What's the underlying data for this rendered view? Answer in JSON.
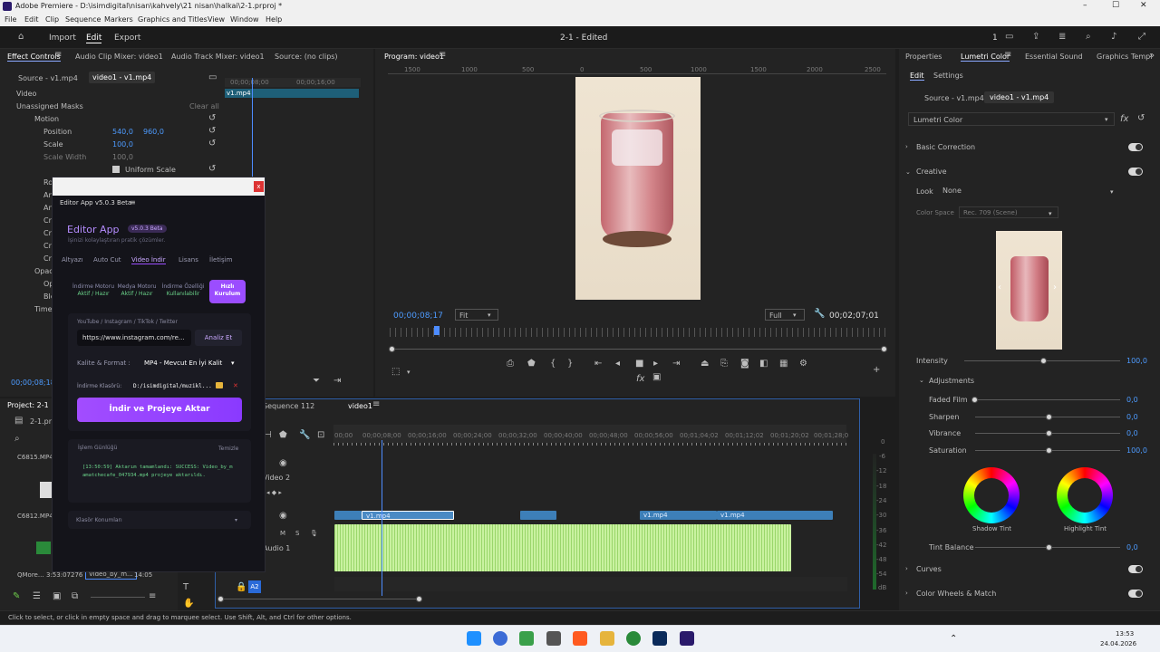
{
  "titlebar": {
    "title": "Adobe Premiere - D:\\isimdigital\\nisan\\kahvely\\21 nisan\\halkai\\2-1.prproj *",
    "minimize": "–",
    "maximize": "☐",
    "close": "✕"
  },
  "menu": [
    "File",
    "Edit",
    "Clip",
    "Sequence",
    "Markers",
    "Graphics and Titles",
    "View",
    "Window",
    "Help"
  ],
  "appbar": {
    "home_icon": "home-icon",
    "tabs": [
      "Import",
      "Edit",
      "Export"
    ],
    "active_tab": "Edit",
    "center_title": "2-1 - Edited",
    "right_num": "1"
  },
  "effect_controls": {
    "tabs": [
      "Effect Controls",
      "Audio Clip Mixer: video1",
      "Audio Track Mixer: video1",
      "Source: (no clips)"
    ],
    "source_chip": "Source - v1.mp4",
    "clip_chip": "video1 - v1.mp4",
    "ruler_a": "00;00;08;00",
    "ruler_b": "00;00;16;00",
    "clip_label": "v1.mp4",
    "section_video": "Video",
    "unassigned": "Unassigned Masks",
    "clear_all": "Clear all",
    "motion": "Motion",
    "position": "Position",
    "pos_x": "540,0",
    "pos_y": "960,0",
    "scale": "Scale",
    "scale_val": "100,0",
    "scale_width": "Scale Width",
    "scale_width_val": "100,0",
    "uniform_scale": "Uniform Scale",
    "partial_rows": [
      "Ro",
      "An",
      "An",
      "Cr",
      "Cr",
      "Cr",
      "Cr",
      "Opaci",
      "Op",
      "Ble",
      "Time"
    ],
    "timecode": "00;00;08;18"
  },
  "program": {
    "title": "Program: video1",
    "ruler": [
      "1500",
      "1000",
      "500",
      "0",
      "500",
      "1000",
      "1500",
      "2000",
      "2500"
    ],
    "timecode": "00;00;08;17",
    "fit": "Fit",
    "full": "Full",
    "duration": "00;02;07;01"
  },
  "lumetri": {
    "tabs": [
      "Properties",
      "Lumetri Color",
      "Essential Sound",
      "Graphics Templ"
    ],
    "subtabs": [
      "Edit",
      "Settings"
    ],
    "source_chip": "Source - v1.mp4",
    "clip_chip": "video1 - v1.mp4",
    "effect_select": "Lumetri Color",
    "basic_correction": "Basic Correction",
    "creative": "Creative",
    "look_label": "Look",
    "look_value": "None",
    "color_space_label": "Color Space",
    "color_space_value": "Rec. 709 (Scene)",
    "intensity_label": "Intensity",
    "intensity_val": "100,0",
    "adjustments": "Adjustments",
    "faded_film": "Faded Film",
    "faded_film_val": "0,0",
    "sharpen": "Sharpen",
    "sharpen_val": "0,0",
    "vibrance": "Vibrance",
    "vibrance_val": "0,0",
    "saturation": "Saturation",
    "saturation_val": "100,0",
    "shadow_tint": "Shadow Tint",
    "highlight_tint": "Highlight Tint",
    "tint_balance": "Tint Balance",
    "tint_balance_val": "0,0",
    "curves": "Curves",
    "color_wheels": "Color Wheels & Match"
  },
  "project": {
    "title": "Project: 2-1",
    "item_a": "2-1.prproj",
    "item_b": "C6815.MP4",
    "item_c": "C6812.MP4",
    "item_d": "QMore...",
    "dur_d": "3:53:07276",
    "item_e": "Video_by_m...",
    "dur_e": "14:05"
  },
  "timeline": {
    "tabs": [
      "Sequence 112",
      "video1"
    ],
    "ruler": [
      "00;00",
      "00;00;08;00",
      "00;00;16;00",
      "00;00;24;00",
      "00;00;32;00",
      "00;00;40;00",
      "00;00;48;00",
      "00;00;56;00",
      "00;01;04;02",
      "00;01;12;02",
      "00;01;20;02",
      "00;01;28;0"
    ],
    "track_video2": "Video 2",
    "track_audio1": "Audio 1",
    "clip_labels": [
      "v1.mp4",
      "v1.mp4",
      "v1.mp4"
    ],
    "meter_labels": [
      "0",
      "-6",
      "-12",
      "-18",
      "-24",
      "-30",
      "-36",
      "-42",
      "-48",
      "-54",
      "dB"
    ]
  },
  "editor_app": {
    "window_title": "Editor App v5.0.3 Beta",
    "close": "x",
    "brand": "Editor App",
    "version_badge": "v5.0.3 Beta",
    "subtitle": "İşinizi kolaylaştıran pratik çözümler.",
    "tabs": [
      "Altyazı",
      "Auto Cut",
      "Video İndir",
      "Lisans",
      "İletişim"
    ],
    "active_tab": "Video İndir",
    "status_pills": [
      {
        "title": "İndirme Motoru",
        "status": "Aktif / Hazır"
      },
      {
        "title": "Medya Motoru",
        "status": "Aktif / Hazır"
      },
      {
        "title": "İndirme Özelliği",
        "status": "Kullanılabilir"
      },
      {
        "title": "Hızlı",
        "status": "Kurulum"
      }
    ],
    "sources_label": "YouTube / Instagram / TikTok / Twitter",
    "url_value": "https://www.instagram.com/re...",
    "analyze": "Analiz Et",
    "quality_label": "Kalite & Format :",
    "quality_value": "MP4 - Mevcut En İyi Kalit",
    "folder_label": "İndirme Klasörü:",
    "folder_value": "D:/isimdigital/muzikl...",
    "action_button": "İndir ve Projeye Aktar",
    "log_title": "İşlem Günlüğü",
    "clear_log": "Temizle",
    "log_text": "[13:50:59] Aktarım tamamlandı: SUCCESS: Video_by_mamatchecafe_047934.mp4 projeye aktarıldı.",
    "folders": "Klasör Konumları",
    "accent": "#9b4dff"
  },
  "status_text": "Click to select, or click in empty space and drag to marquee select. Use Shift, Alt, and Ctrl for other options.",
  "taskbar": {
    "time": "13:53",
    "date": "24.04.2026"
  }
}
